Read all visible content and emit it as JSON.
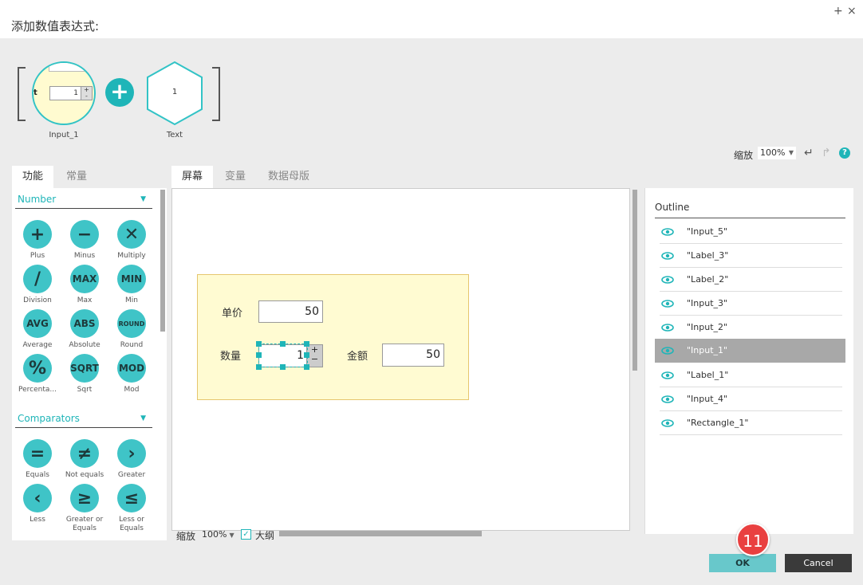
{
  "dialog": {
    "title": "添加数值表达式:",
    "plus_glyph": "+",
    "close_glyph": "×"
  },
  "expression": {
    "node1": {
      "stub_letter": "t",
      "value": "1",
      "label": "Input_1"
    },
    "operator": "+",
    "node2": {
      "value": "1",
      "label": "Text"
    }
  },
  "toolbar": {
    "zoom_label": "缩放",
    "zoom_value": "100%",
    "undo_glyph": "↵",
    "redo_glyph": "↱",
    "help_glyph": "?"
  },
  "left_tabs": [
    "功能",
    "常量"
  ],
  "sections": [
    {
      "title": "Number",
      "buttons": [
        {
          "glyph": "+",
          "label": "Plus"
        },
        {
          "glyph": "−",
          "label": "Minus"
        },
        {
          "glyph": "✕",
          "label": "Multiply"
        },
        {
          "glyph": "/",
          "label": "Division"
        },
        {
          "glyph": "MAX",
          "label": "Max"
        },
        {
          "glyph": "MIN",
          "label": "Min"
        },
        {
          "glyph": "AVG",
          "label": "Average"
        },
        {
          "glyph": "ABS",
          "label": "Absolute"
        },
        {
          "glyph": "ROUND",
          "label": "Round"
        },
        {
          "glyph": "%",
          "label": "Percenta..."
        },
        {
          "glyph": "SQRT",
          "label": "Sqrt"
        },
        {
          "glyph": "MOD",
          "label": "Mod"
        }
      ]
    },
    {
      "title": "Comparators",
      "buttons": [
        {
          "glyph": "=",
          "label": "Equals"
        },
        {
          "glyph": "≠",
          "label": "Not equals"
        },
        {
          "glyph": "›",
          "label": "Greater"
        },
        {
          "glyph": "‹",
          "label": "Less"
        },
        {
          "glyph": "≥",
          "label": "Greater or Equals"
        },
        {
          "glyph": "≤",
          "label": "Less or Equals"
        }
      ]
    }
  ],
  "screen_tabs": [
    "屏幕",
    "变量",
    "数据母版"
  ],
  "canvas": {
    "price_label": "单价",
    "price_value": "50",
    "qty_label": "数量",
    "qty_value": "1",
    "qty_step_up": "+",
    "qty_step_down": "−",
    "total_label": "金额",
    "total_value": "50"
  },
  "canvas_footer": {
    "zoom_label": "缩放",
    "zoom_value": "100%",
    "checkbox_mark": "✓",
    "outline_checkbox_label": "大纲"
  },
  "outline": {
    "title": "Outline",
    "items": [
      "\"Input_5\"",
      "\"Label_3\"",
      "\"Label_2\"",
      "\"Input_3\"",
      "\"Input_2\"",
      "\"Input_1\"",
      "\"Label_1\"",
      "\"Input_4\"",
      "\"Rectangle_1\""
    ],
    "selected_index": 5
  },
  "footer": {
    "ok_label": "OK",
    "cancel_label": "Cancel",
    "step_badge": "11"
  },
  "colors": {
    "accent": "#1fb5b8",
    "button_circle": "#3fc4c7",
    "selection": "#a8a8a8",
    "badge": "#e94040"
  }
}
